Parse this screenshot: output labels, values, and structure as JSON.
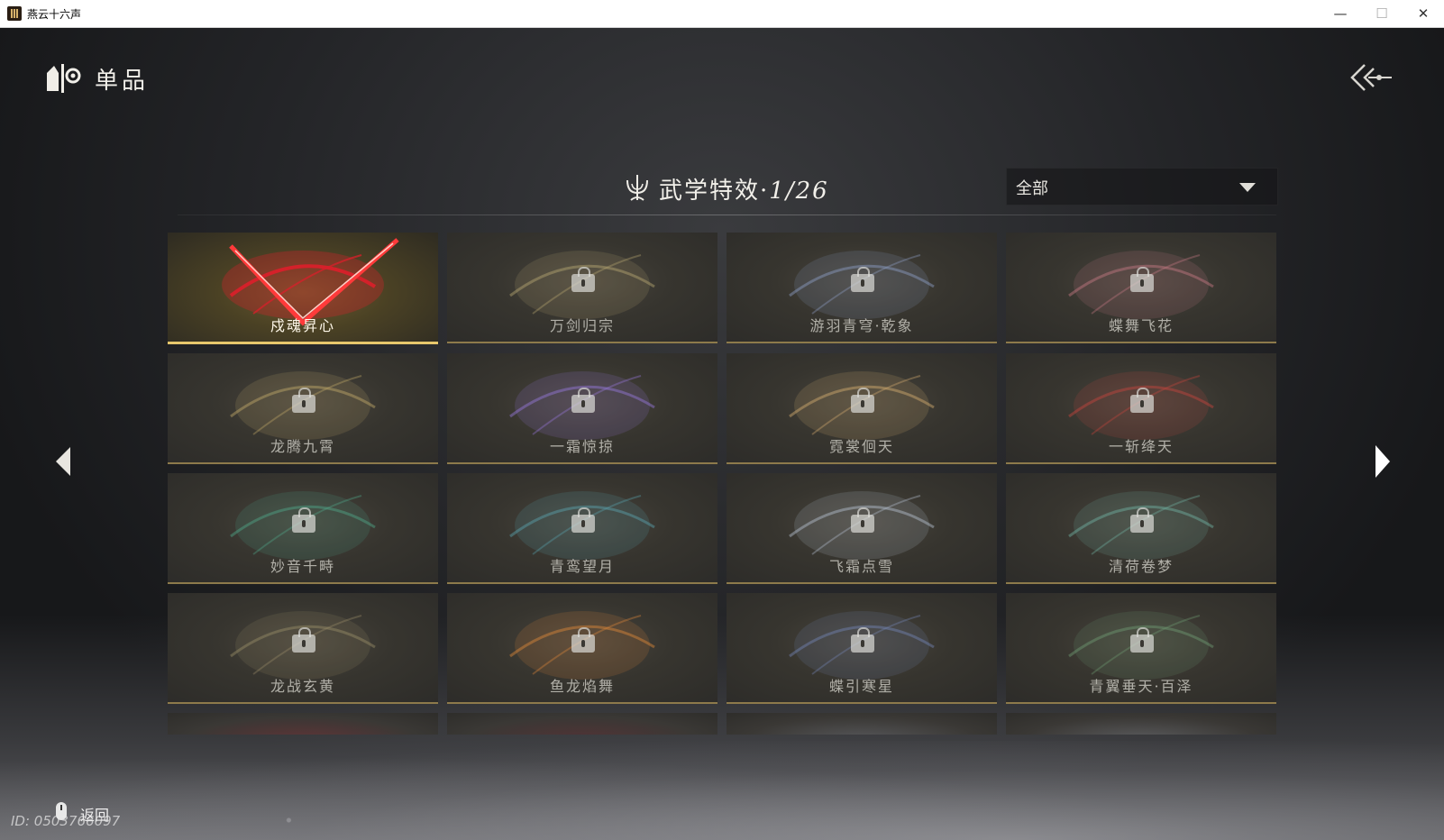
{
  "window": {
    "title": "燕云十六声",
    "controls": {
      "minimize": "—",
      "maximize": "☐",
      "close": "✕"
    }
  },
  "page": {
    "title": "单品",
    "category_icon": "item-category-icon",
    "back_icon": "back-arrow-icon"
  },
  "header": {
    "title": "武学特效",
    "separator": "·",
    "count": "1/26",
    "icon": "trident-emblem-icon"
  },
  "filter": {
    "selected": "全部",
    "icon": "chevron-down-icon"
  },
  "grid": {
    "items": [
      {
        "name": "戍魂昇心",
        "locked": false,
        "selected": true,
        "accent": "#d8202a"
      },
      {
        "name": "万剑归宗",
        "locked": true,
        "selected": false,
        "accent": "#b9a873"
      },
      {
        "name": "游羽青穹·乾象",
        "locked": true,
        "selected": false,
        "accent": "#8fa0c8"
      },
      {
        "name": "蝶舞飞花",
        "locked": true,
        "selected": false,
        "accent": "#c77b86"
      },
      {
        "name": "龙腾九霄",
        "locked": true,
        "selected": false,
        "accent": "#c4ab6a"
      },
      {
        "name": "一霜惊掠",
        "locked": true,
        "selected": false,
        "accent": "#9a7be0"
      },
      {
        "name": "霓裳佪天",
        "locked": true,
        "selected": false,
        "accent": "#d8b071"
      },
      {
        "name": "一斩绛天",
        "locked": true,
        "selected": false,
        "accent": "#c8453e"
      },
      {
        "name": "妙音千畤",
        "locked": true,
        "selected": false,
        "accent": "#4fa88a"
      },
      {
        "name": "青鸾望月",
        "locked": true,
        "selected": false,
        "accent": "#5aa3b0"
      },
      {
        "name": "飞霜点雪",
        "locked": true,
        "selected": false,
        "accent": "#b8c3d3"
      },
      {
        "name": "清荷卷梦",
        "locked": true,
        "selected": false,
        "accent": "#71b3a4"
      },
      {
        "name": "龙战玄黄",
        "locked": true,
        "selected": false,
        "accent": "#9a8d68"
      },
      {
        "name": "鱼龙焰舞",
        "locked": true,
        "selected": false,
        "accent": "#e0893a"
      },
      {
        "name": "蝶引寒星",
        "locked": true,
        "selected": false,
        "accent": "#7486b5"
      },
      {
        "name": "青翼垂天·百泽",
        "locked": true,
        "selected": false,
        "accent": "#6f9c73"
      }
    ],
    "partial_row": [
      {
        "accent": "#a22a2a"
      },
      {
        "accent": "#7a2222"
      },
      {
        "accent": "#888888"
      },
      {
        "accent": "#9a9a9a"
      }
    ]
  },
  "navigation": {
    "prev_icon": "chevron-left-icon",
    "next_icon": "chevron-right-icon"
  },
  "footer": {
    "back_hint": "返回",
    "mouse_icon": "mouse-right-click-icon",
    "uid": "ID: 0503766097"
  },
  "colors": {
    "selected_border": "#e7c76c",
    "locked_border": "#8d7a4b",
    "background": "#1a1b1d"
  }
}
